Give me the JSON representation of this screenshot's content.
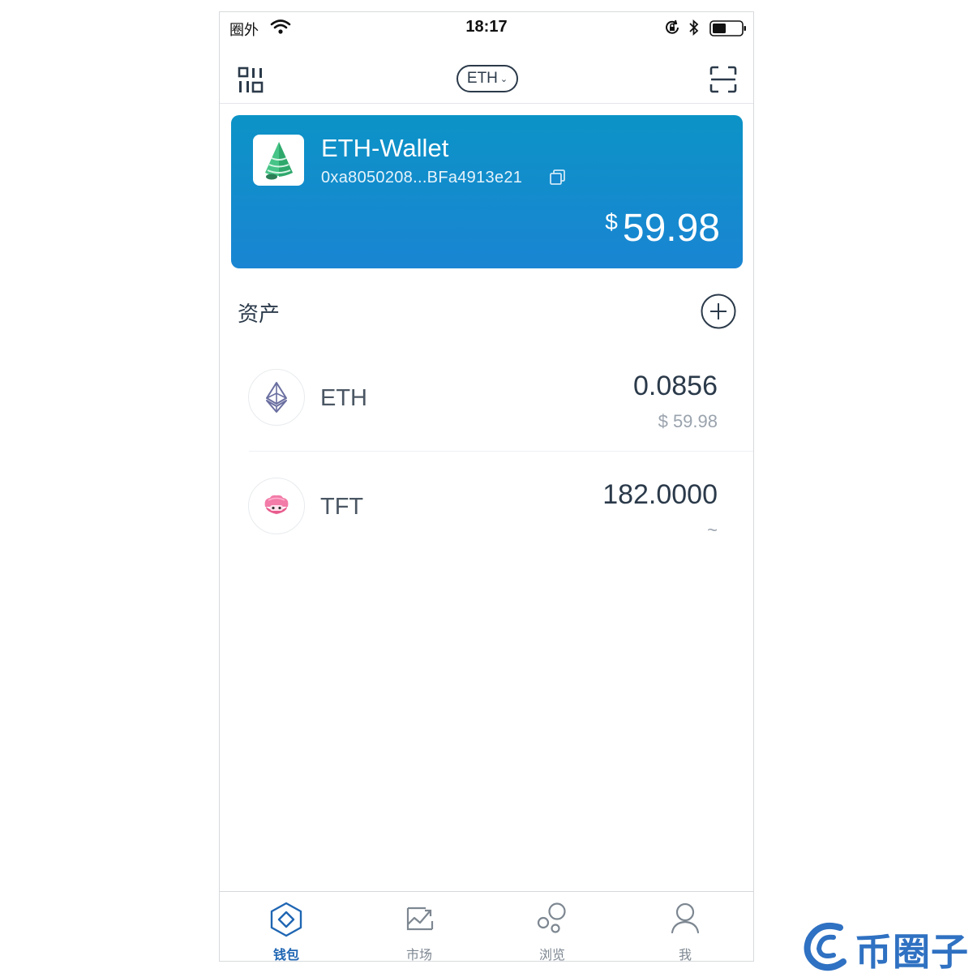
{
  "status_bar": {
    "carrier": "圈外",
    "time": "18:17"
  },
  "nav": {
    "chain": "ETH"
  },
  "wallet": {
    "name": "ETH-Wallet",
    "address": "0xa8050208...BFa4913e21",
    "currency_symbol": "$",
    "balance": "59.98"
  },
  "assets": {
    "title": "资产",
    "items": [
      {
        "symbol": "ETH",
        "amount": "0.0856",
        "value": "$ 59.98",
        "icon": "ethereum-icon"
      },
      {
        "symbol": "TFT",
        "amount": "182.0000",
        "value": "~",
        "icon": "tft-shell-icon"
      }
    ]
  },
  "tabs": [
    {
      "label": "钱包",
      "icon": "wallet-diamond-icon",
      "active": true
    },
    {
      "label": "市场",
      "icon": "market-chart-icon",
      "active": false
    },
    {
      "label": "浏览",
      "icon": "browse-bubbles-icon",
      "active": false
    },
    {
      "label": "我",
      "icon": "profile-icon",
      "active": false
    }
  ],
  "watermark": {
    "text": "币圈子"
  },
  "colors": {
    "card_gradient_top": "#0c93c6",
    "card_gradient_bottom": "#1a85d3",
    "active_tab": "#1f66b3",
    "text_primary": "#2b3a4a",
    "text_secondary": "#9aa3ad"
  }
}
